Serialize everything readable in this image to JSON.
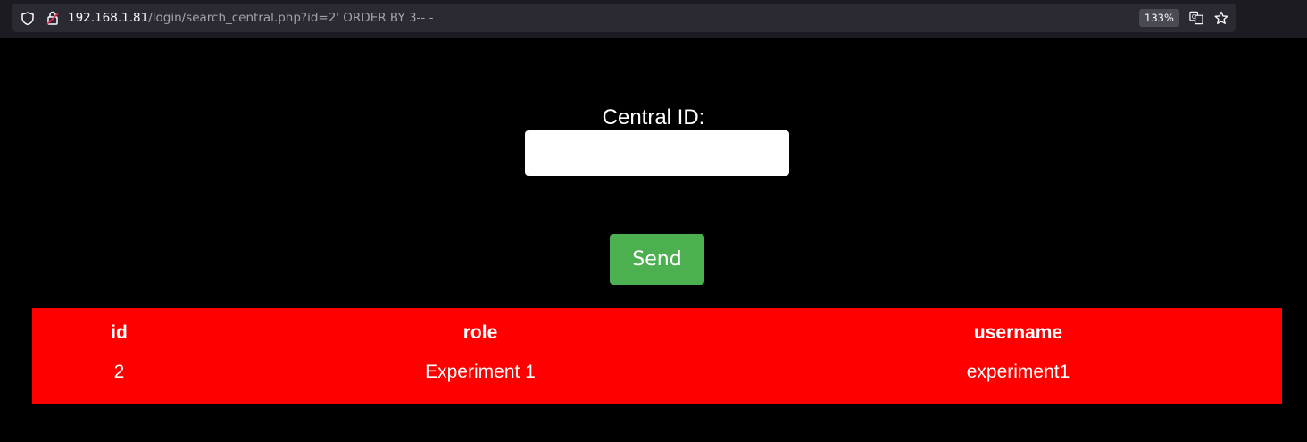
{
  "browser": {
    "url_host": "192.168.1.81",
    "url_rest": "/login/search_central.php?id=2' ORDER BY 3-- -",
    "zoom": "133%",
    "icons": [
      "shield-icon",
      "lock-icon",
      "translate-icon",
      "star-icon"
    ]
  },
  "form": {
    "label": "Central ID:",
    "input_value": "",
    "send_label": "Send"
  },
  "table": {
    "headers": [
      "id",
      "role",
      "username"
    ],
    "rows": [
      [
        "2",
        "Experiment 1",
        "experiment1"
      ]
    ]
  },
  "colors": {
    "page_bg": "#000000",
    "table_bg": "#ff0000",
    "button_bg": "#4caf50",
    "input_bg": "#ffffff"
  }
}
